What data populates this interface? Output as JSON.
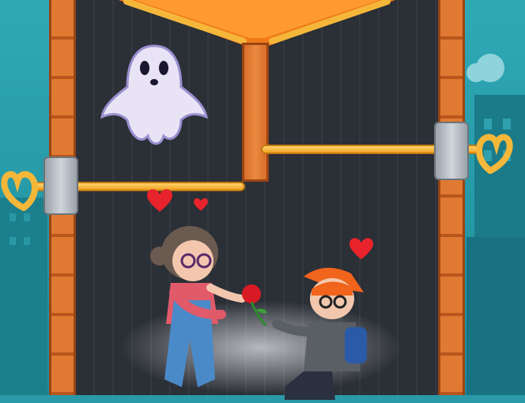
{
  "scene": {
    "ghost": "ghost-enemy",
    "girl": "girl-character",
    "boy": "boy-character",
    "rose": "rose-icon",
    "hearts": [
      "heart-icon",
      "heart-icon",
      "heart-icon"
    ],
    "pins": [
      "pin-top-right",
      "pin-left"
    ],
    "colors": {
      "wall": "#e07a32",
      "pin": "#f5b73a",
      "lava": "#f07a1a",
      "chamber": "#2b2f36"
    }
  }
}
